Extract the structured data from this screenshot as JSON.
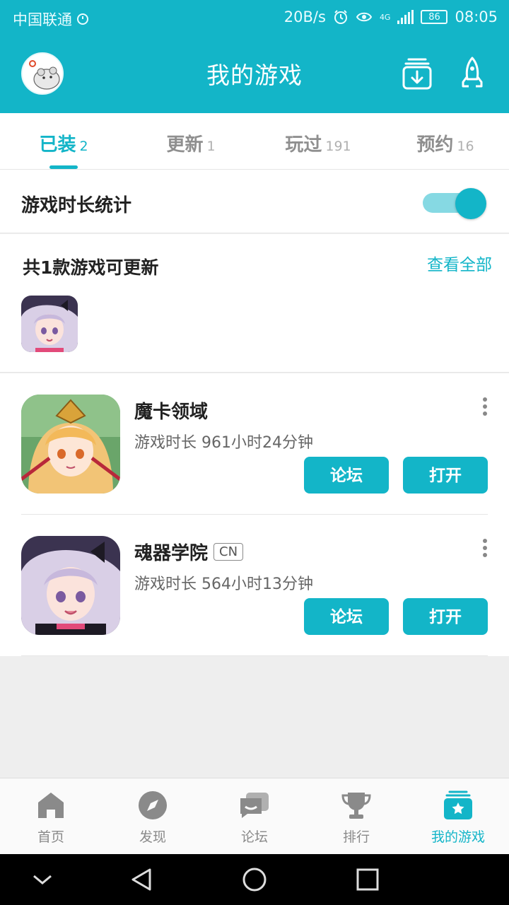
{
  "status_bar": {
    "carrier": "中国联通",
    "speed": "20B/s",
    "network": "4G",
    "battery": "86",
    "time": "08:05"
  },
  "header": {
    "title": "我的游戏"
  },
  "tabs": [
    {
      "label": "已装",
      "count": "2",
      "active": true
    },
    {
      "label": "更新",
      "count": "1",
      "active": false
    },
    {
      "label": "玩过",
      "count": "191",
      "active": false
    },
    {
      "label": "预约",
      "count": "16",
      "active": false
    }
  ],
  "playtime_stats": {
    "label": "游戏时长统计",
    "enabled": true
  },
  "updates": {
    "heading": "共1款游戏可更新",
    "view_all": "查看全部"
  },
  "games": [
    {
      "name": "魔卡领域",
      "badge": "",
      "playtime": "游戏时长 961小时24分钟",
      "forum_label": "论坛",
      "open_label": "打开"
    },
    {
      "name": "魂器学院",
      "badge": "CN",
      "playtime": "游戏时长 564小时13分钟",
      "forum_label": "论坛",
      "open_label": "打开"
    }
  ],
  "bottom_nav": [
    {
      "label": "首页",
      "icon": "home-icon",
      "active": false
    },
    {
      "label": "发现",
      "icon": "compass-icon",
      "active": false
    },
    {
      "label": "论坛",
      "icon": "forum-icon",
      "active": false
    },
    {
      "label": "排行",
      "icon": "trophy-icon",
      "active": false
    },
    {
      "label": "我的游戏",
      "icon": "my-games-icon",
      "active": true
    }
  ],
  "colors": {
    "accent": "#13b5c8",
    "accent_light": "#86d9e3",
    "inactive": "#8a8a8a"
  }
}
